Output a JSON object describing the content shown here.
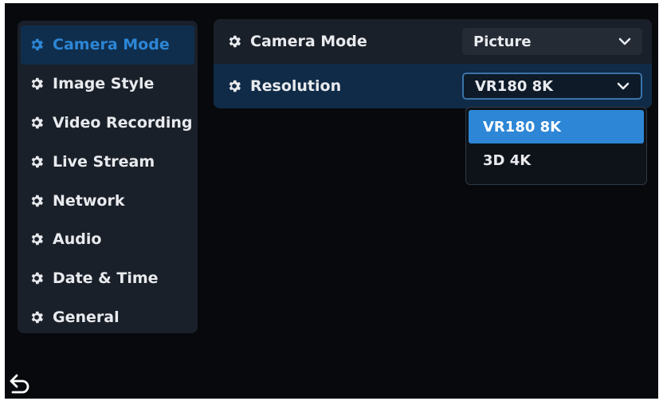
{
  "sidebar": {
    "items": [
      {
        "label": "Camera Mode",
        "active": true
      },
      {
        "label": "Image Style"
      },
      {
        "label": "Video Recording"
      },
      {
        "label": "Live Stream"
      },
      {
        "label": "Network"
      },
      {
        "label": "Audio"
      },
      {
        "label": "Date & Time"
      },
      {
        "label": "General"
      }
    ]
  },
  "settings": {
    "camera_mode": {
      "label": "Camera Mode",
      "value": "Picture"
    },
    "resolution": {
      "label": "Resolution",
      "value": "VR180 8K"
    }
  },
  "dropdown": {
    "options": [
      {
        "label": "VR180 8K",
        "selected": true
      },
      {
        "label": "3D 4K"
      }
    ]
  },
  "icons": {
    "sidebar_item": "gear-icon",
    "setting_row": "gear-icon",
    "select": "chevron-down-icon",
    "back": "back-arrow-icon"
  },
  "colors": {
    "background": "#07090d",
    "panel": "#1a2029",
    "accent": "#2d86d6",
    "active_row": "#102b47",
    "text": "#e8eaee"
  }
}
